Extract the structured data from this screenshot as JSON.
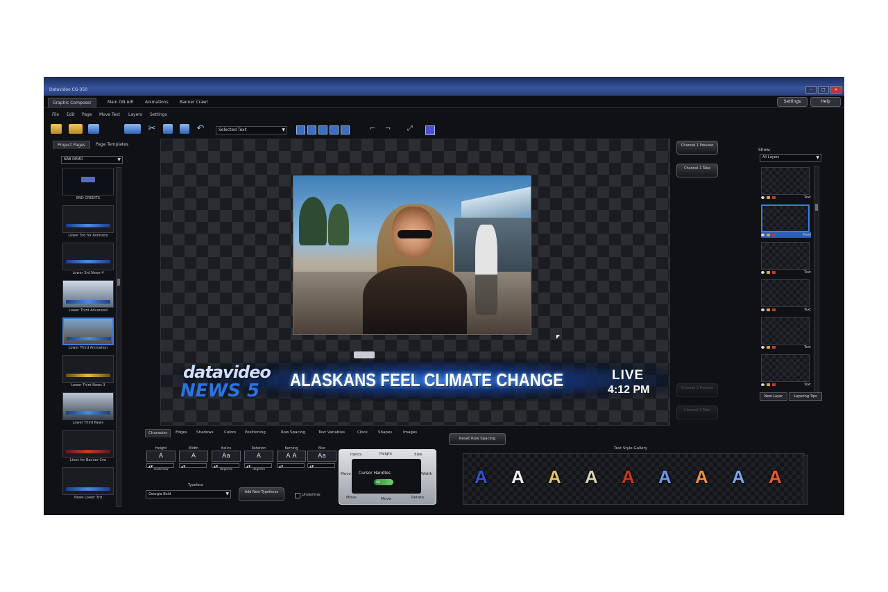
{
  "window": {
    "title": "Datavideo CG-350"
  },
  "app_tabs": [
    {
      "label": "Graphic Composer"
    },
    {
      "label": "Main ON AIR"
    },
    {
      "label": "Animations"
    },
    {
      "label": "Banner Crawl"
    }
  ],
  "top_buttons": {
    "settings": "Settings",
    "help": "Help"
  },
  "menu": [
    "File",
    "Edit",
    "Page",
    "Move Text",
    "Layers",
    "Settings"
  ],
  "toolbar": {
    "selected_text": "Selected Text"
  },
  "left_panel": {
    "tabs": [
      "Project Pages",
      "Page Templates"
    ],
    "dropdown": "NAB DEMO",
    "thumbnails": [
      "END CREDITS",
      "Lower 3rd for Animatio",
      "Lower 3rd News 4",
      "Lower Third Advanced",
      "Lower Third Animation",
      "Lower Third News 3",
      "Lower Third News",
      "Lines for Banner Crw",
      "News Lower 3rd"
    ]
  },
  "stage": {
    "logo_top": "datavideo",
    "logo_bottom": "NEWS 5",
    "headline": "ALASKANS FEEL CLIMATE CHANGE",
    "live": "LIVE",
    "time": "4:12 PM"
  },
  "channel_buttons": {
    "ch1_preview": "Channel 1 Preview",
    "ch1_take": "Channel 1 Take",
    "ch2_preview": "Channel 2 Preview",
    "ch2_take": "Channel 2 Take"
  },
  "right_panel": {
    "label": "Show:",
    "dropdown": "All Layers",
    "layers": [
      "Text",
      "Main",
      "Text",
      "Text",
      "Text",
      "Text"
    ],
    "new_layer": "New Layer",
    "layering_tips": "Layering Tips"
  },
  "bottom_tabs": [
    "Character",
    "Edges",
    "Shadows",
    "Colors",
    "Positioning",
    "Row Spacing",
    "Text Variables",
    "Clock",
    "Shapes",
    "Images"
  ],
  "character": {
    "controls": [
      {
        "label": "Height",
        "glyph": "A",
        "unit": "scale/row"
      },
      {
        "label": "Width",
        "glyph": "A",
        "unit": ""
      },
      {
        "label": "Italics",
        "glyph": "Aa",
        "unit": "degrees"
      },
      {
        "label": "Rotation",
        "glyph": "A",
        "unit": "degrees"
      },
      {
        "label": "Kerning",
        "glyph": "A A",
        "unit": ""
      },
      {
        "label": "Blur",
        "glyph": "Aa",
        "unit": ""
      }
    ],
    "typeface_label": "Typeface",
    "typeface": "Georgia Bold",
    "add_typefaces": "Add New Typefaces",
    "underline": "Underline"
  },
  "cursor_handles": {
    "title": "Cursor Handles",
    "top": [
      "Italics",
      "Height",
      "Size"
    ],
    "left": "Move",
    "right": "Width",
    "bottom": [
      "Move",
      "Move",
      "Rotate"
    ],
    "toggle": "ON"
  },
  "reset_row_spacing": "Reset Row Spacing",
  "gallery": {
    "title": "Text Style Gallery",
    "letters": [
      {
        "char": "A",
        "color": "#3a4fcf"
      },
      {
        "char": "A",
        "color": "#f2f2f2"
      },
      {
        "char": "A",
        "color": "#e0c36a"
      },
      {
        "char": "A",
        "color": "#d8d0b0"
      },
      {
        "char": "A",
        "color": "#c8381f"
      },
      {
        "char": "A",
        "color": "#6c98e8"
      },
      {
        "char": "A",
        "color": "#e8904a"
      },
      {
        "char": "A",
        "color": "#7ea2e8"
      },
      {
        "char": "A",
        "color": "#e85b2a"
      }
    ]
  }
}
